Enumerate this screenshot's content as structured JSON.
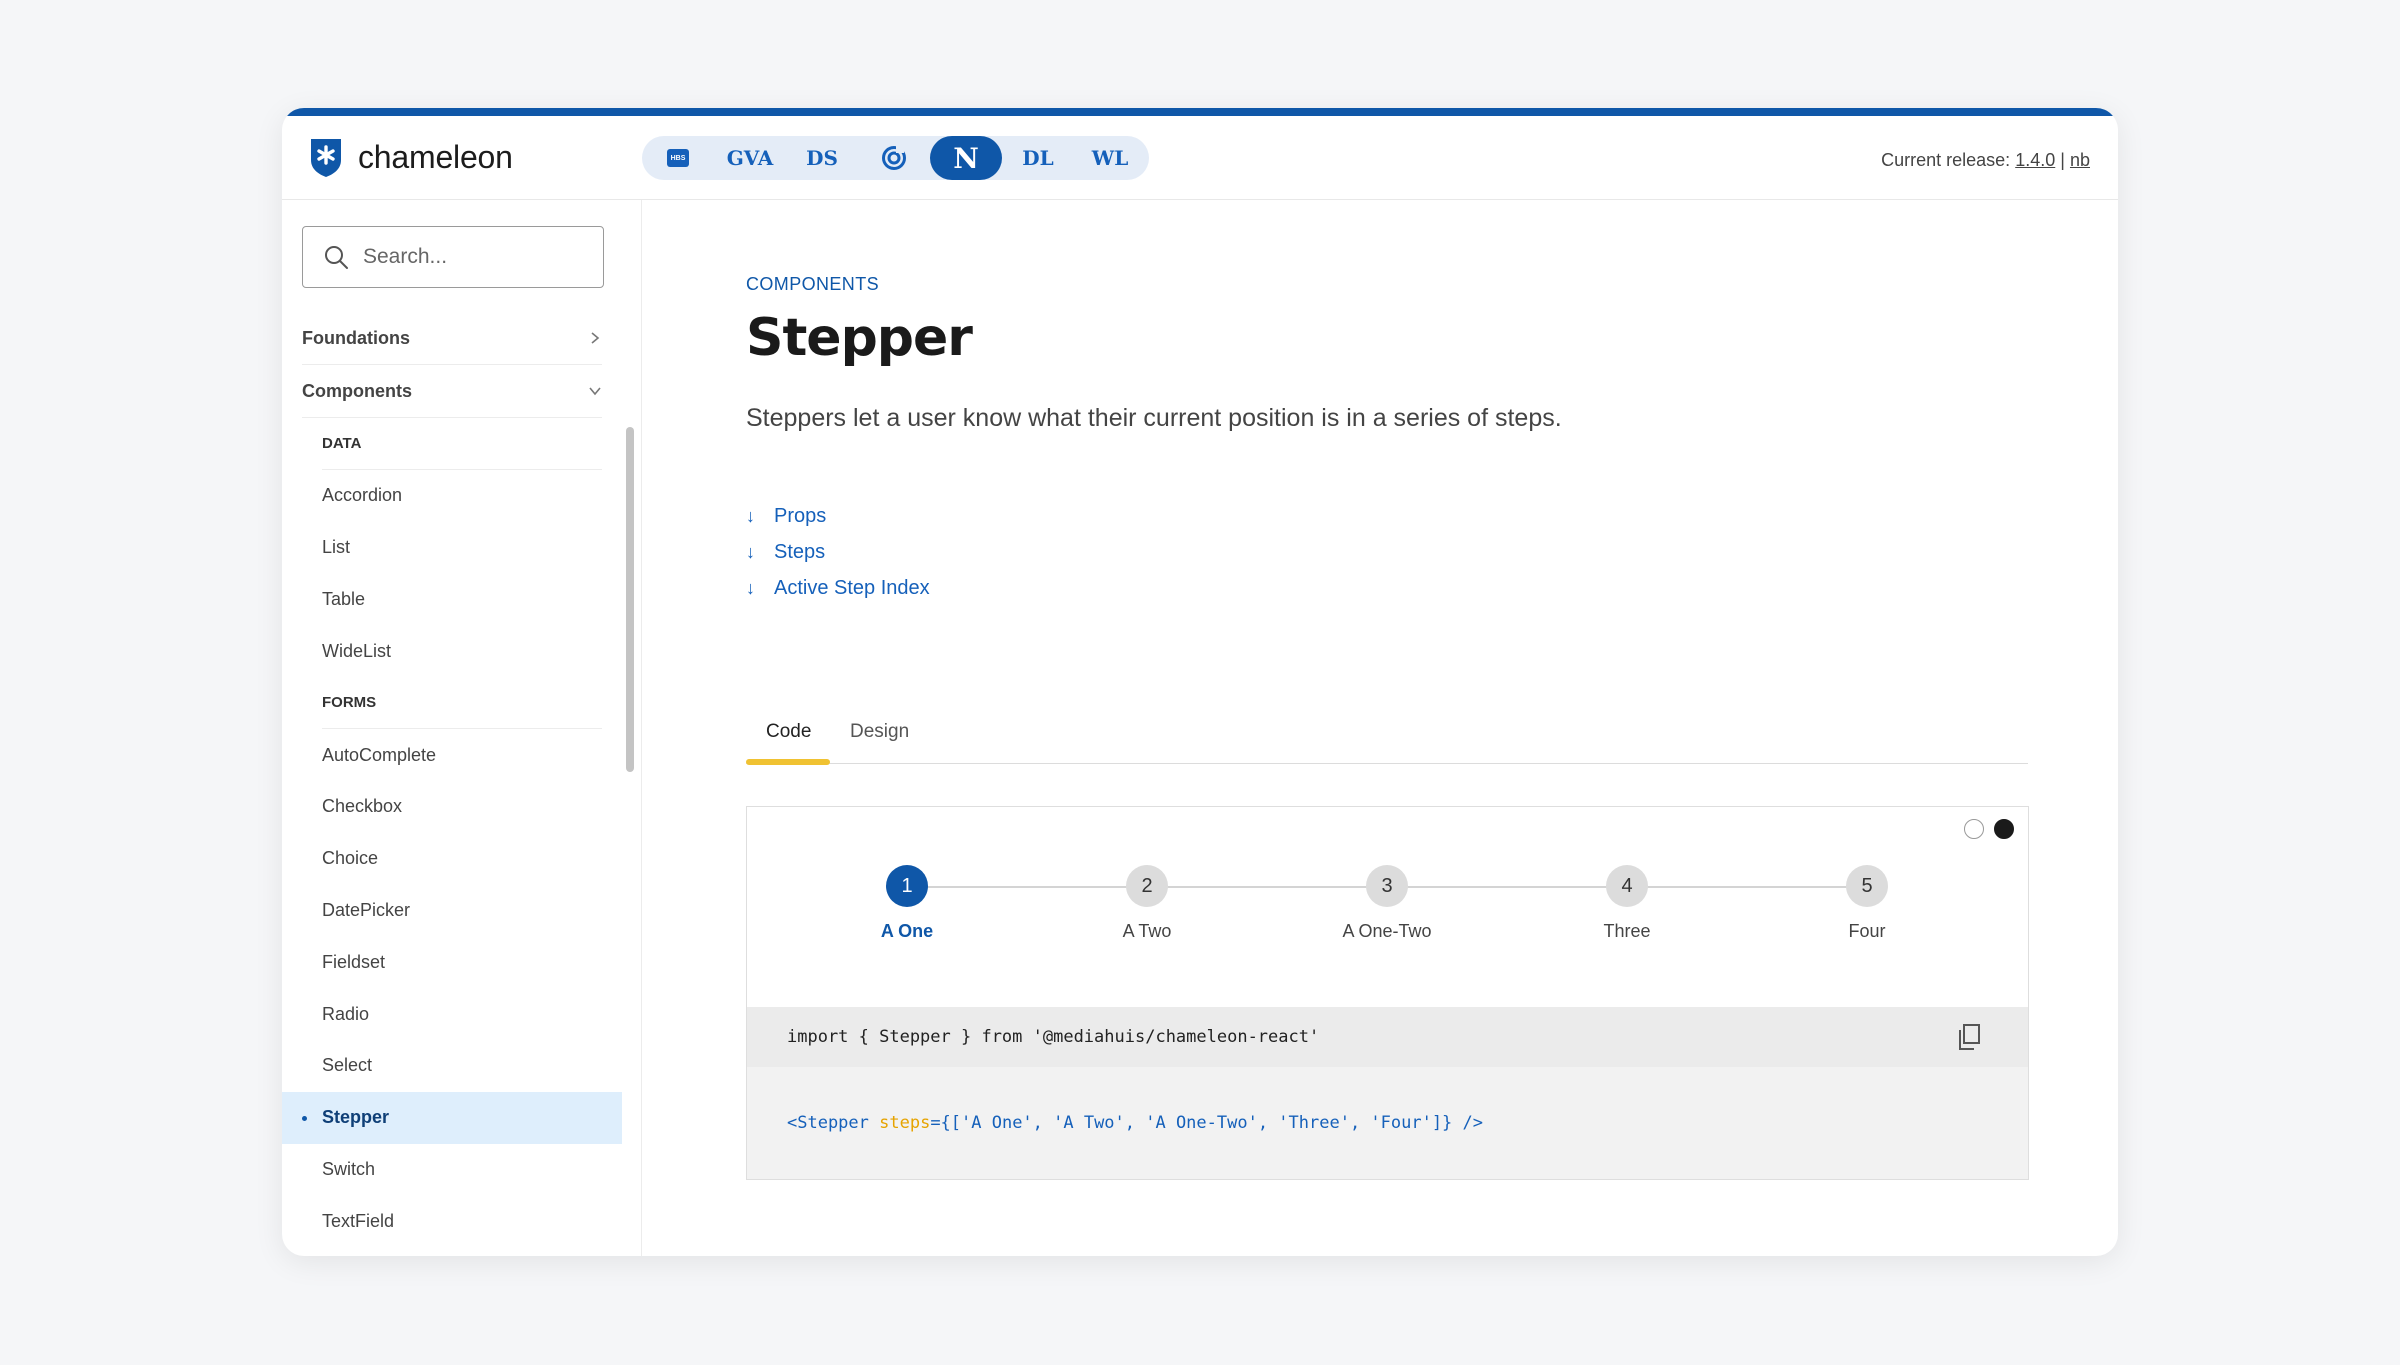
{
  "header": {
    "logo_text": "chameleon",
    "brands": [
      {
        "label": "HBS",
        "icon": "hbs-shield-icon"
      },
      {
        "label": "GVA"
      },
      {
        "label": "DS"
      },
      {
        "label": "",
        "icon": "swirl-logo-icon"
      },
      {
        "label": "N",
        "active": true
      },
      {
        "label": "DL"
      },
      {
        "label": "WL"
      }
    ],
    "release_prefix": "Current release:",
    "release_version": "1.4.0",
    "release_separator": "|",
    "release_locale": "nb"
  },
  "sidebar": {
    "search_placeholder": "Search...",
    "groups": [
      {
        "label": "Foundations"
      },
      {
        "label": "Components"
      }
    ],
    "sections": [
      {
        "header": "DATA",
        "items": [
          "Accordion",
          "List",
          "Table",
          "WideList"
        ]
      },
      {
        "header": "FORMS",
        "items": [
          "AutoComplete",
          "Checkbox",
          "Choice",
          "DatePicker",
          "Fieldset",
          "Radio",
          "Select",
          "Stepper",
          "Switch",
          "TextField"
        ]
      }
    ],
    "active_item": "Stepper"
  },
  "main": {
    "eyebrow": "COMPONENTS",
    "title": "Stepper",
    "lead": "Steppers let a user know what their current position is in a series of steps.",
    "toc": [
      "Props",
      "Steps",
      "Active Step Index"
    ],
    "tabs": [
      "Code",
      "Design"
    ],
    "active_tab": "Code",
    "steps": [
      {
        "num": "1",
        "label": "A One",
        "active": true
      },
      {
        "num": "2",
        "label": "A Two"
      },
      {
        "num": "3",
        "label": "A One-Two"
      },
      {
        "num": "4",
        "label": "Three"
      },
      {
        "num": "5",
        "label": "Four"
      }
    ],
    "code_import": "import { Stepper } from '@mediahuis/chameleon-react'",
    "code_usage_tag_open": "<Stepper ",
    "code_usage_attr": "steps",
    "code_usage_value": "={['A One', 'A Two', 'A One-Two', 'Three', 'Four']} />"
  },
  "colors": {
    "primary": "#0f57a8",
    "accent": "#f0c232",
    "active_bg": "#deeefc"
  }
}
